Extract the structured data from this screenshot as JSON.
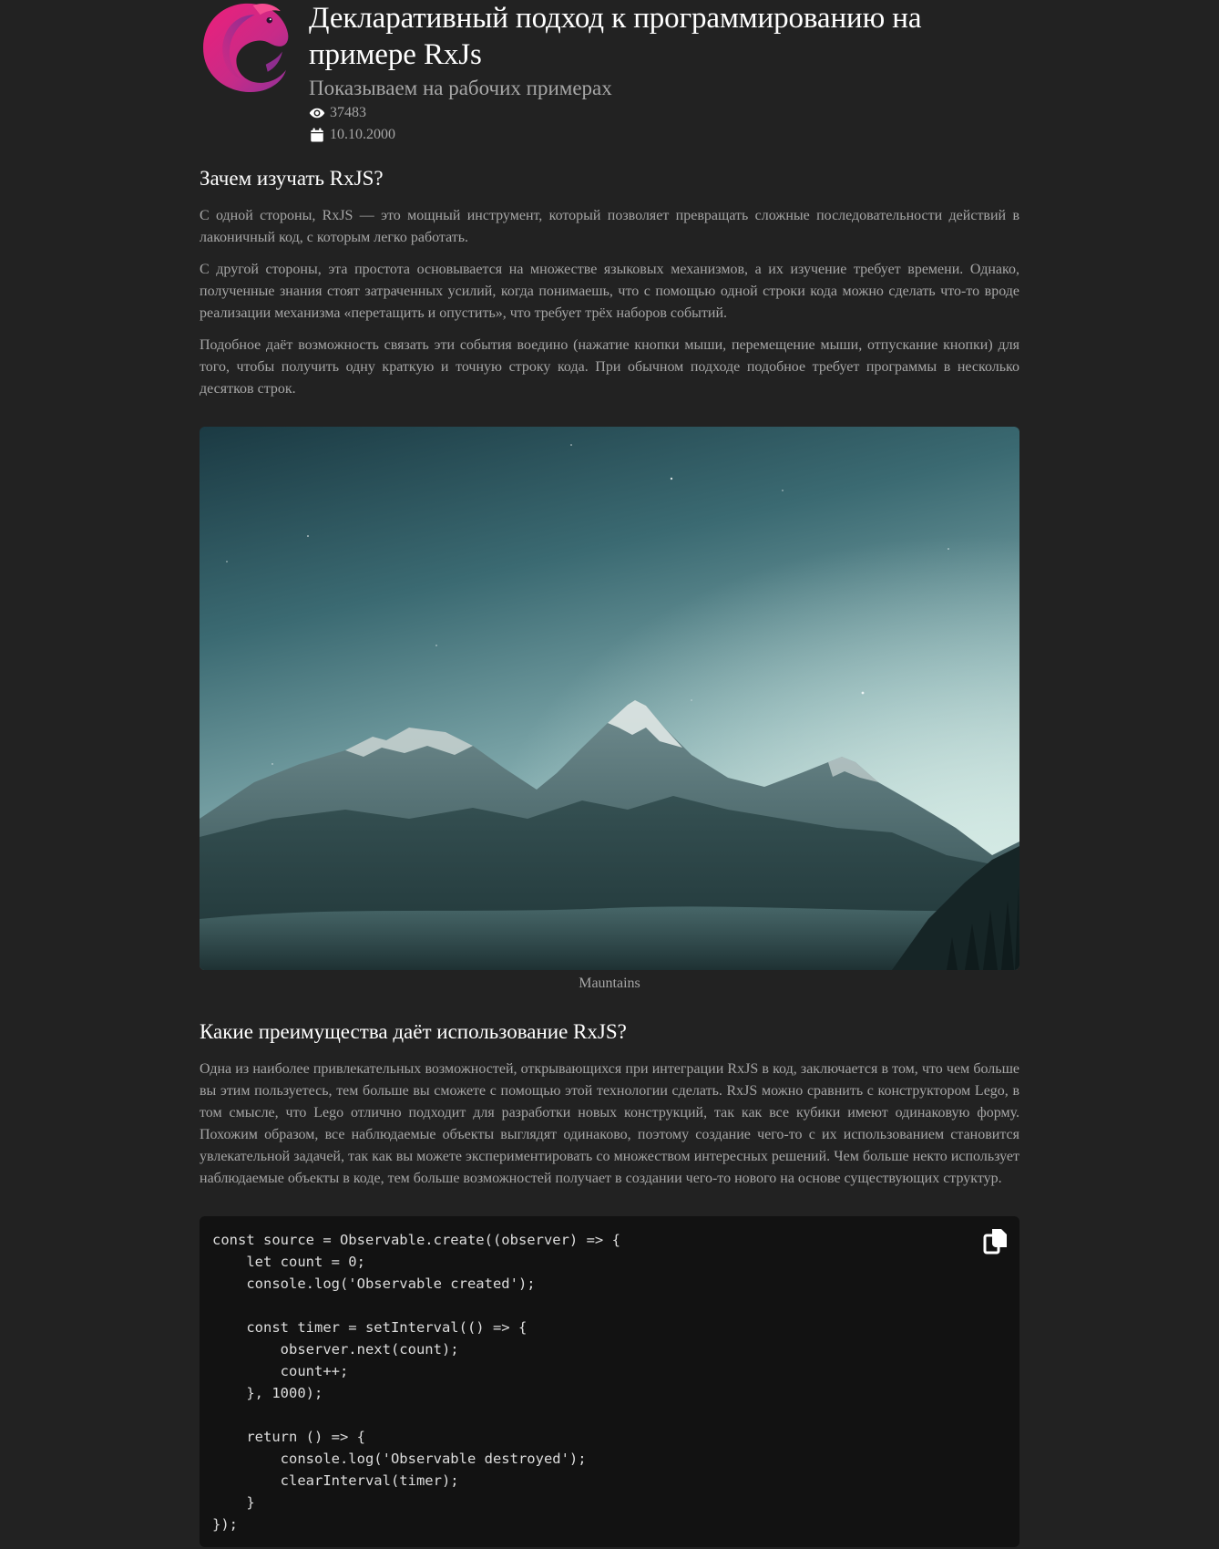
{
  "header": {
    "title": "Декларативный подход к программированию на примере RxJs",
    "subtitle": "Показываем на рабочих примерах",
    "views": "37483",
    "date": "10.10.2000",
    "logo_icon": "rxjs-logo-icon",
    "views_icon": "eye-icon",
    "date_icon": "calendar-icon"
  },
  "section1": {
    "heading": "Зачем изучать RxJS?",
    "paragraphs": [
      "С одной стороны, RxJS — это мощный инструмент, который позволяет превращать сложные последовательности действий в лаконичный код, с которым легко работать.",
      "С другой стороны, эта простота основывается на множестве языковых механизмов, а их изучение требует времени. Однако, полученные знания стоят затраченных усилий, когда понимаешь, что с помощью одной строки кода можно сделать что-то вроде реализации механизма «перетащить и опустить», что требует трёх наборов событий.",
      "Подобное даёт возможность связать эти события воедино (нажатие кнопки мыши, перемещение мыши, отпускание кнопки) для того, чтобы получить одну краткую и точную строку кода. При обычном подходе подобное требует программы в несколько десятков строк."
    ]
  },
  "figure": {
    "caption": "Mauntains"
  },
  "section2": {
    "heading": "Какие преимущества даёт использование RxJS?",
    "paragraph": "Одна из наиболее привлекательных возможностей, открывающихся при интеграции RxJS в код, заключается в том, что чем больше вы этим пользуетесь, тем больше вы сможете с помощью этой технологии сделать. RxJS можно сравнить с конструктором Lego, в том смысле, что Lego отлично подходит для разработки новых конструкций, так как все кубики имеют одинаковую форму. Похожим образом, все наблюдаемые объекты выглядят одинаково, поэтому создание чего-то с их использованием становится увлекательной задачей, так как вы можете экспериментировать со множеством интересных решений. Чем больше некто использует наблюдаемые объекты в коде, тем больше возможностей получает в создании чего-то нового на основе существующих структур."
  },
  "code": {
    "copy_icon": "copy-icon",
    "text": "const source = Observable.create((observer) => {\n    let count = 0;\n    console.log('Observable created');\n\n    const timer = setInterval(() => {\n        observer.next(count);\n        count++;\n    }, 1000);\n\n    return () => {\n        console.log('Observable destroyed');\n        clearInterval(timer);\n    }\n});"
  },
  "colors": {
    "background": "#222222",
    "heading": "#ffffff",
    "text": "#a6a6a6",
    "code_background": "#121212",
    "logo_pink": "#e5236e",
    "logo_purple": "#a3329a"
  }
}
